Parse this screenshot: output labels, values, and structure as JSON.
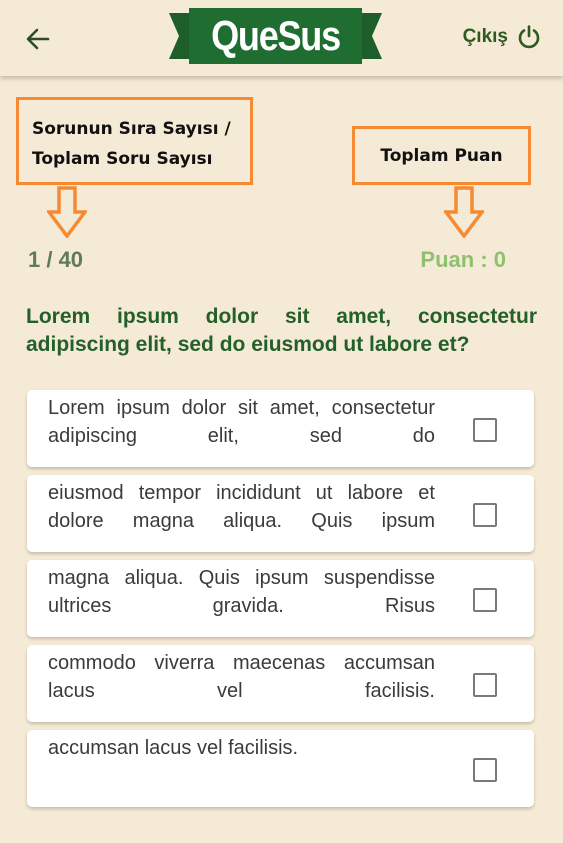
{
  "header": {
    "logo_text": "QueSus",
    "logout_label": "Çıkış",
    "back_icon": "arrow-left-icon",
    "logout_icon": "power-icon",
    "brand_color": "#1e6a2f"
  },
  "callouts": {
    "left_line1": "Sorunun Sıra Sayısı /",
    "left_line2": "Toplam Soru Sayısı",
    "right": "Toplam Puan",
    "border_color": "#f58a33"
  },
  "status": {
    "progress": "1 / 40",
    "score": "Puan : 0"
  },
  "question": "Lorem ipsum dolor sit amet, consectetur adipiscing elit, sed do eiusmod ut labore et?",
  "options": [
    {
      "text": "Lorem ipsum dolor sit amet, consectetur adipiscing elit, sed do",
      "checked": false
    },
    {
      "text": "eiusmod tempor incididunt ut labore et dolore magna aliqua. Quis ipsum",
      "checked": false
    },
    {
      "text": "magna aliqua. Quis ipsum suspendisse ultrices gravida. Risus",
      "checked": false
    },
    {
      "text": "commodo viverra maecenas accumsan lacus vel facilisis.",
      "checked": false
    },
    {
      "text": "accumsan lacus vel facilisis.",
      "checked": false
    }
  ]
}
